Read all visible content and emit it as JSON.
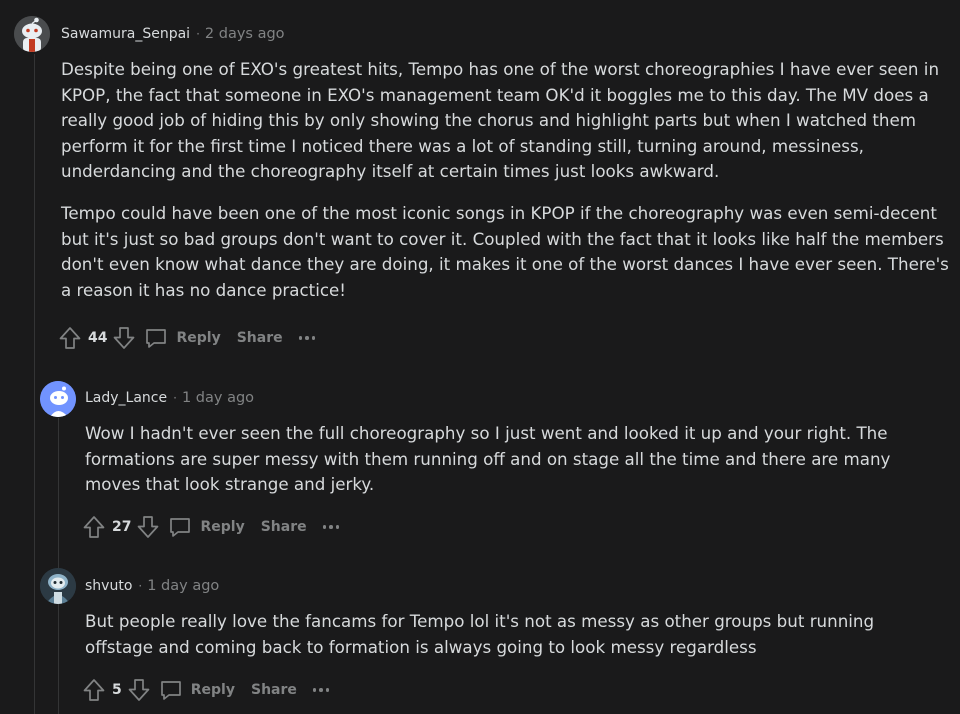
{
  "comments": [
    {
      "username": "Sawamura_Senpai",
      "time": "2 days ago",
      "avatar_icon": "snoo-avatar-icon",
      "paragraphs": [
        "Despite being one of EXO's greatest hits, Tempo has one of the worst choreographies I have ever seen in KPOP, the fact that someone in EXO's management team OK'd it boggles me to this day. The MV does a really good job of hiding this by only showing the chorus and highlight parts but when I watched them perform it for the first time I noticed there was a lot of standing still, turning around, messiness, underdancing and the choreography itself at certain times just looks awkward.",
        "Tempo could have been one of the most iconic songs in KPOP if the choreography was even semi-decent but it's just so bad groups don't want to cover it. Coupled with the fact that it looks like half the members don't even know what dance they are doing, it makes it one of the worst dances I have ever seen. There's a reason it has no dance practice!"
      ],
      "score": "44",
      "reply_label": "Reply",
      "share_label": "Share"
    },
    {
      "username": "Lady_Lance",
      "time": "1 day ago",
      "avatar_icon": "default-avatar-icon",
      "paragraphs": [
        "Wow I hadn't ever seen the full choreography so I just went and looked it up and your right. The formations are super messy with them running off and on stage all the time and there are many moves that look strange and jerky."
      ],
      "score": "27",
      "reply_label": "Reply",
      "share_label": "Share"
    },
    {
      "username": "shvuto",
      "time": "1 day ago",
      "avatar_icon": "snoo-avatar-icon",
      "paragraphs": [
        "But people really love the fancams for Tempo lol it's not as messy as other groups but running offstage and coming back to formation is always going to look messy regardless"
      ],
      "score": "5",
      "reply_label": "Reply",
      "share_label": "Share"
    }
  ],
  "colors": {
    "background": "#1a1a1b",
    "text": "#d7dadc",
    "muted": "#818384",
    "thread_line": "#343536",
    "avatar_blue": "#7193ff"
  }
}
